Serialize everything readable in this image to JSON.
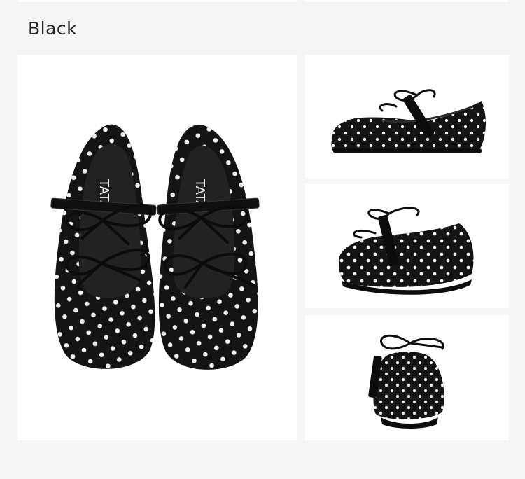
{
  "color_label": "Black",
  "brand_mark": "TATA",
  "colors": {
    "shoe": "#141414",
    "dot": "#f2f2f2",
    "panel": "#ffffff",
    "page": "#f5f5f5"
  },
  "views": [
    {
      "label": "top-view"
    },
    {
      "label": "side-view"
    },
    {
      "label": "three-quarter-rear-view"
    },
    {
      "label": "rear-view"
    }
  ]
}
